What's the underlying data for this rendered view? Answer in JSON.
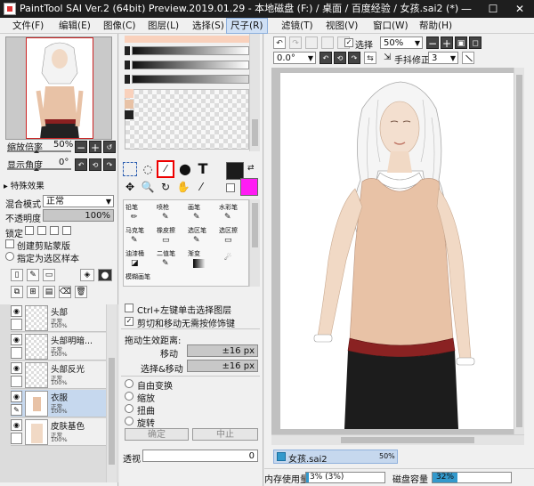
{
  "title": "PaintTool SAI Ver.2 (64bit) Preview.2019.01.29 - 本地磁盘 (F:) / 桌面 / 百度经验 / 女孩.sai2 (*)",
  "window_controls": {
    "minimize": "—",
    "maximize": "☐",
    "close": "✕"
  },
  "menu": [
    "文件(F)",
    "编辑(E)",
    "图像(C)",
    "图层(L)",
    "选择(S)",
    "尺子(R)",
    "滤镜(T)",
    "视图(V)",
    "窗口(W)",
    "帮助(H)"
  ],
  "navigator": {
    "zoom_label": "缩放倍率",
    "zoom_value": "50%",
    "angle_label": "显示角度",
    "angle_value": "0°"
  },
  "special_effects": {
    "label": "特殊效果"
  },
  "layer_props": {
    "blend_label": "混合模式",
    "blend_value": "正常",
    "opacity_label": "不透明度",
    "opacity_value": "100%",
    "lock_label": "锁定",
    "clip_label": "创建剪贴蒙版",
    "sample_label": "指定为选区样本"
  },
  "layers": [
    {
      "name": "头部",
      "mode": "正常",
      "opacity": "100%"
    },
    {
      "name": "头部明暗...",
      "mode": "正常",
      "opacity": "100%"
    },
    {
      "name": "头部反光",
      "mode": "正常",
      "opacity": "100%"
    },
    {
      "name": "衣服",
      "mode": "正常",
      "opacity": "100%"
    },
    {
      "name": "皮肤基色",
      "mode": "正常",
      "opacity": "100%"
    }
  ],
  "tools": [
    [
      "铅笔",
      "喷枪",
      "画笔",
      "水彩笔"
    ],
    [
      "马克笔",
      "橡皮擦",
      "选区笔",
      "选区擦"
    ],
    [
      "油漆桶",
      "二值笔",
      "渐变",
      ""
    ],
    [
      "模糊画笔",
      "",
      "",
      ""
    ]
  ],
  "tool_options": {
    "ctrl_select": "Ctrl+左键单击选择图层",
    "cut_move": "剪切和移动无需按修饰键",
    "drag_label": "拖动生效距离:",
    "move_label": "移动",
    "move_value": "±16 px",
    "sel_move_label": "选择&移动",
    "sel_move_value": "±16 px",
    "transforms": [
      "自由变换",
      "缩放",
      "扭曲",
      "旋转"
    ],
    "confirm": "确定",
    "cancel": "中止",
    "transparency_label": "透视",
    "transparency_value": "0"
  },
  "canvas_toolbar": {
    "select_label": "选择",
    "zoom_value": "50%",
    "angle_value": "0.0°",
    "stabilizer_label": "手抖修正",
    "stabilizer_value": "3"
  },
  "tab": {
    "name": "女孩.sai2",
    "zoom": "50%"
  },
  "status": {
    "memory_label": "内存使用量",
    "memory_value": "3% (3%)",
    "disk_label": "磁盘容量",
    "disk_value": "32%"
  },
  "colors": {
    "primary": "#1b1b1b",
    "secondary": "#ff1cf4"
  }
}
